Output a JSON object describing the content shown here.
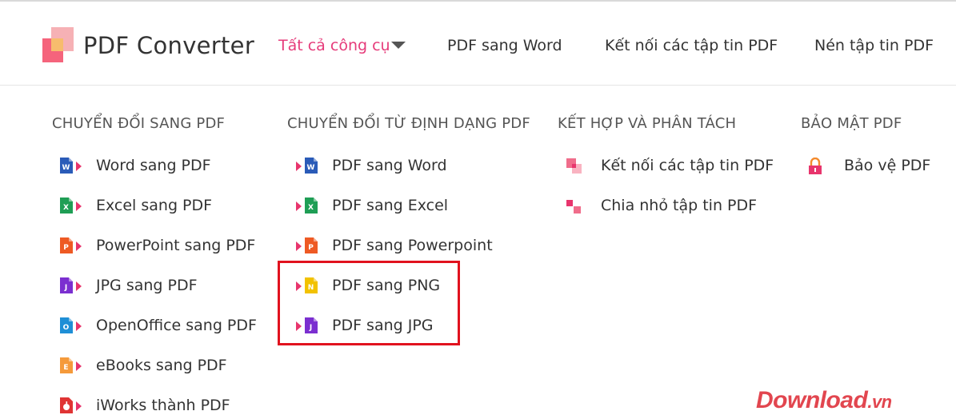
{
  "header": {
    "brand": "PDF Converter",
    "nav": {
      "all_tools": "Tất cả công cụ",
      "pdf_to_word": "PDF sang Word",
      "merge_pdf": "Kết nối các tập tin PDF",
      "compress_pdf": "Nén tập tin PDF"
    }
  },
  "menu": {
    "to_pdf": {
      "title": "CHUYỂN ĐỔI SANG PDF",
      "items": [
        {
          "label": "Word sang PDF",
          "icon": "word-icon",
          "letter": "W",
          "color": "#2a5bb8"
        },
        {
          "label": "Excel sang PDF",
          "icon": "excel-icon",
          "letter": "X",
          "color": "#1f9e55"
        },
        {
          "label": "PowerPoint sang PDF",
          "icon": "powerpoint-icon",
          "letter": "P",
          "color": "#ee5a24"
        },
        {
          "label": "JPG sang PDF",
          "icon": "jpg-icon",
          "letter": "J",
          "color": "#7b2fd0"
        },
        {
          "label": "OpenOffice sang PDF",
          "icon": "openoffice-icon",
          "letter": "O",
          "color": "#1f8fd6"
        },
        {
          "label": "eBooks sang PDF",
          "icon": "ebook-icon",
          "letter": "E",
          "color": "#f59a3b"
        },
        {
          "label": "iWorks thành PDF",
          "icon": "iworks-icon",
          "letter": "",
          "color": "#e03434"
        }
      ]
    },
    "from_pdf": {
      "title": "CHUYỂN ĐỔI TỪ ĐỊNH DẠNG PDF",
      "items": [
        {
          "label": "PDF sang Word",
          "icon": "word-icon",
          "letter": "W",
          "color": "#2a5bb8"
        },
        {
          "label": "PDF sang Excel",
          "icon": "excel-icon",
          "letter": "X",
          "color": "#1f9e55"
        },
        {
          "label": "PDF sang Powerpoint",
          "icon": "powerpoint-icon",
          "letter": "P",
          "color": "#ee5a24"
        },
        {
          "label": "PDF sang PNG",
          "icon": "png-icon",
          "letter": "N",
          "color": "#f2c200"
        },
        {
          "label": "PDF sang JPG",
          "icon": "jpg-icon",
          "letter": "J",
          "color": "#7b2fd0"
        }
      ]
    },
    "merge_split": {
      "title": "KẾT HỢP VÀ PHÂN TÁCH",
      "items": [
        {
          "label": "Kết nối các tập tin PDF",
          "icon": "merge-icon"
        },
        {
          "label": "Chia nhỏ tập tin PDF",
          "icon": "split-icon"
        }
      ]
    },
    "security": {
      "title": "BẢO MẬT PDF",
      "items": [
        {
          "label": "Bảo vệ PDF",
          "icon": "lock-icon"
        }
      ]
    }
  },
  "watermark": {
    "text": "Download",
    "suffix": ".vn"
  },
  "colors": {
    "accent": "#e63b7a",
    "highlight": "#e1121e",
    "arrow": "#e8356d"
  }
}
